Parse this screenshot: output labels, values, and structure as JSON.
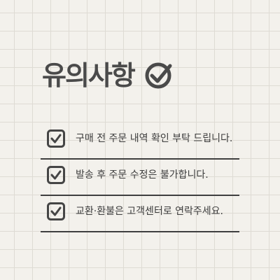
{
  "heading": {
    "title": "유의사항",
    "icon": "check-circle-icon"
  },
  "notices": [
    {
      "text": "구매 전 주문 내역 확인 부탁 드립니다.",
      "icon": "checkbox-checked-icon"
    },
    {
      "text": "발송 후 주문 수정은 불가합니다.",
      "icon": "checkbox-checked-icon"
    },
    {
      "text": "교환·환불은 고객센터로 연락주세요.",
      "icon": "checkbox-checked-icon"
    }
  ],
  "colors": {
    "background": "#f3f1ec",
    "grid": "#dedbd4",
    "ink": "#424242"
  }
}
